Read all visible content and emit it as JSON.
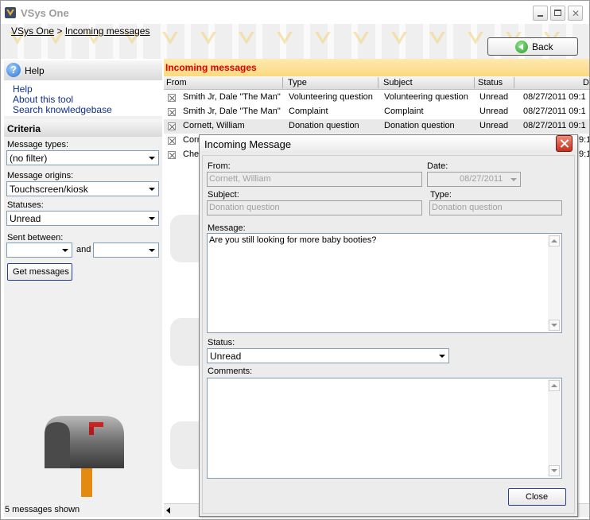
{
  "window": {
    "title": "VSys One"
  },
  "breadcrumb": {
    "root": "VSys One",
    "separator": ">",
    "current": "Incoming messages"
  },
  "back_button": {
    "label": "Back"
  },
  "help": {
    "title": "Help",
    "links": [
      "Help",
      "About this tool",
      "Search knowledgebase"
    ]
  },
  "criteria": {
    "title": "Criteria",
    "message_types": {
      "label": "Message types:",
      "value": "(no filter)"
    },
    "message_origins": {
      "label": "Message origins:",
      "value": "Touchscreen/kiosk"
    },
    "statuses": {
      "label": "Statuses:",
      "value": "Unread"
    },
    "sent_between": {
      "label": "Sent between:",
      "from": "",
      "and_label": "and",
      "to": ""
    },
    "get_button": "Get messages"
  },
  "status_bar": {
    "left": "5 messages shown"
  },
  "grid": {
    "title": "Incoming messages",
    "columns": [
      "From",
      "Type",
      "Subject",
      "Status",
      "D"
    ],
    "rows": [
      {
        "from": "Smith Jr, Dale \"The Man\"",
        "type": "Volunteering question",
        "subject": "Volunteering question",
        "status": "Unread",
        "date": "08/27/2011 09:1"
      },
      {
        "from": "Smith Jr, Dale \"The Man\"",
        "type": "Complaint",
        "subject": "Complaint",
        "status": "Unread",
        "date": "08/27/2011 09:1"
      },
      {
        "from": "Cornett, William",
        "type": "Donation question",
        "subject": "Donation question",
        "status": "Unread",
        "date": "08/27/2011 09:1"
      },
      {
        "from": "Corn",
        "type": "",
        "subject": "",
        "status": "",
        "date": "9:1"
      },
      {
        "from": "Che",
        "type": "",
        "subject": "",
        "status": "",
        "date": "9:1"
      }
    ]
  },
  "dialog": {
    "title": "Incoming Message",
    "from_label": "From:",
    "from_value": "Cornett, William",
    "date_label": "Date:",
    "date_value": "08/27/2011",
    "subject_label": "Subject:",
    "subject_value": "Donation question",
    "type_label": "Type:",
    "type_value": "Donation question",
    "message_label": "Message:",
    "message_value": "Are you still looking for more baby booties?",
    "status_label": "Status:",
    "status_value": "Unread",
    "comments_label": "Comments:",
    "comments_value": "",
    "close_button": "Close"
  },
  "colors": {
    "grid_title": "#e00000",
    "header_band": "#fbd97f",
    "back_icon": "#2e9b2c",
    "dialog_close": "#c5301c"
  }
}
